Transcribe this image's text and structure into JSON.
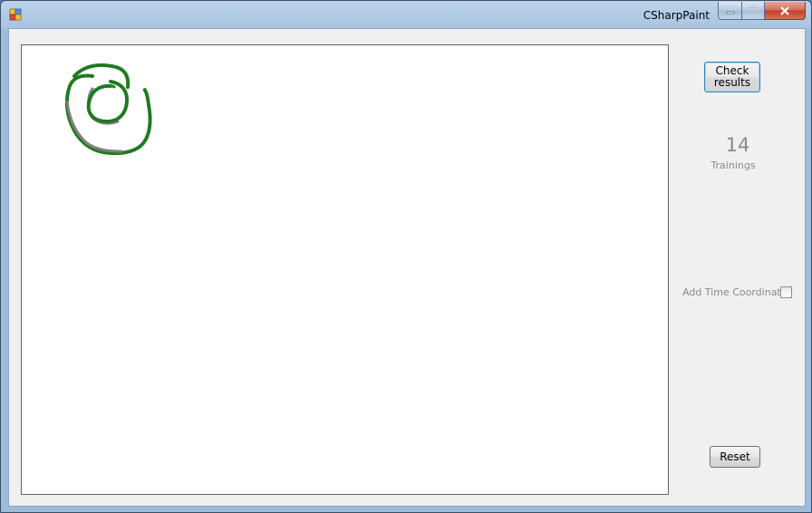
{
  "window": {
    "title": "CSharpPaint",
    "icon": "app-icon"
  },
  "caption": {
    "minimize_icon": "minimize-icon",
    "maximize_icon": "maximize-icon",
    "close_icon": "close-icon"
  },
  "controls": {
    "check_results_label": "Check results",
    "trainings_count": "14",
    "trainings_label": "Trainings",
    "time_coordinate_label": "Add Time Coordinate",
    "time_coordinate_checked": false,
    "reset_label": "Reset"
  },
  "drawing": {
    "description_colors": {
      "stroke_green": "#1e7a1e",
      "stroke_gray": "#808080"
    }
  },
  "colors": {
    "accent": "#3c7fb1",
    "disabled_text": "#8a8a8a"
  }
}
